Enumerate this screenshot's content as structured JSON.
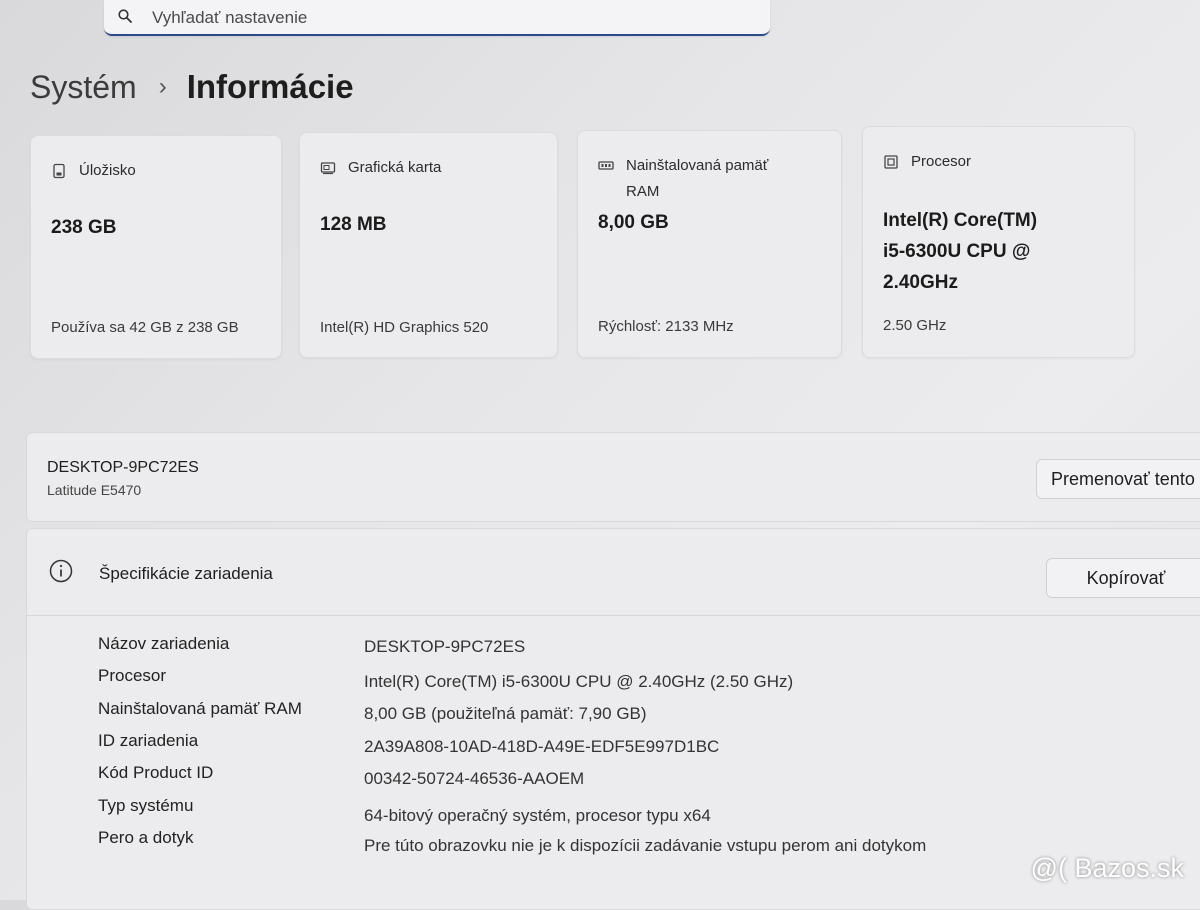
{
  "search": {
    "placeholder": "Vyhľadať nastavenie",
    "value": ""
  },
  "breadcrumb": {
    "parent": "Systém",
    "separator": "›",
    "current": "Informácie"
  },
  "cards": {
    "storage": {
      "title": "Úložisko",
      "value": "238 GB",
      "sub": "Používa sa 42 GB z 238 GB"
    },
    "graphics": {
      "title": "Grafická karta",
      "value": "128 MB",
      "sub": "Intel(R) HD Graphics 520"
    },
    "ram": {
      "title_line1": "Nainštalovaná pamäť",
      "title_line2": "RAM",
      "value": "8,00 GB",
      "sub": "Rýchlosť: 2133 MHz"
    },
    "cpu": {
      "title": "Procesor",
      "value_line1": "Intel(R) Core(TM)",
      "value_line2": "i5-6300U CPU @",
      "value_line3": "2.40GHz",
      "sub": "2.50 GHz"
    }
  },
  "device": {
    "name": "DESKTOP-9PC72ES",
    "model": "Latitude E5470",
    "rename_label": "Premenovať tento"
  },
  "specs": {
    "title": "Špecifikácie zariadenia",
    "copy_label": "Kopírovať",
    "rows": [
      {
        "label": "Názov zariadenia",
        "value": "DESKTOP-9PC72ES"
      },
      {
        "label": "Procesor",
        "value": "Intel(R) Core(TM) i5-6300U CPU @ 2.40GHz (2.50 GHz)"
      },
      {
        "label": "Nainštalovaná pamäť RAM",
        "value": "8,00 GB (použiteľná pamäť: 7,90 GB)"
      },
      {
        "label": "ID zariadenia",
        "value": "2A39A808-10AD-418D-A49E-EDF5E997D1BC"
      },
      {
        "label": "Kód Product ID",
        "value": "00342-50724-46536-AAOEM"
      },
      {
        "label": "Typ systému",
        "value": "64-bitový operačný systém, procesor typu x64"
      },
      {
        "label": "Pero a dotyk",
        "value": "Pre túto obrazovku nie je k dispozícii zadávanie vstupu perom ani dotykom"
      }
    ]
  },
  "watermark": "@( Bazos.sk",
  "colors": {
    "accent": "#2b4a8a",
    "card_bg": "#ececee",
    "page_bg": "#e4e4e6"
  }
}
